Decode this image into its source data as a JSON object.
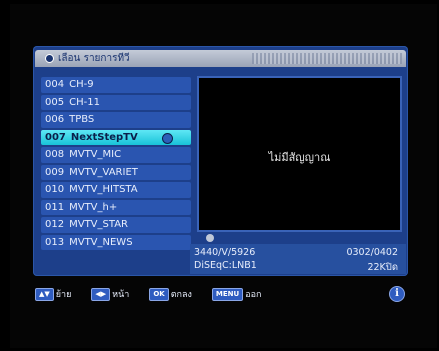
{
  "header": {
    "title": "เลือน รายการทีวี"
  },
  "channels": [
    {
      "num": "004",
      "name": "CH-9"
    },
    {
      "num": "005",
      "name": "CH-11"
    },
    {
      "num": "006",
      "name": "TPBS"
    },
    {
      "num": "007",
      "name": "NextStepTV"
    },
    {
      "num": "008",
      "name": "MVTV_MIC"
    },
    {
      "num": "009",
      "name": "MVTV_VARIET"
    },
    {
      "num": "010",
      "name": "MVTV_HITSTA"
    },
    {
      "num": "011",
      "name": "MVTV_h+"
    },
    {
      "num": "012",
      "name": "MVTV_STAR"
    },
    {
      "num": "013",
      "name": "MVTV_NEWS"
    }
  ],
  "selected_index": 3,
  "preview": {
    "no_signal": "ไม่มีสัญญาณ"
  },
  "info": {
    "transponder": "3440/V/5926",
    "diseqc": "DiSEqC:LNB1",
    "position": "0302/0402",
    "lnb": "22Kปิด"
  },
  "footer": {
    "move_key": "▲▼",
    "move_label": "ย้าย",
    "page_key": "◀▶",
    "page_label": "หน้า",
    "ok_key": "OK",
    "ok_label": "ตกลง",
    "menu_key": "MENU",
    "menu_label": "ออก",
    "info_icon": "i"
  },
  "icons": {
    "globe": "globe-icon",
    "info": "info-icon",
    "dot": "dot-icon"
  },
  "colors": {
    "panel": "#1d3f8a",
    "item": "#2a55b0",
    "selected": "#18c2d8"
  }
}
